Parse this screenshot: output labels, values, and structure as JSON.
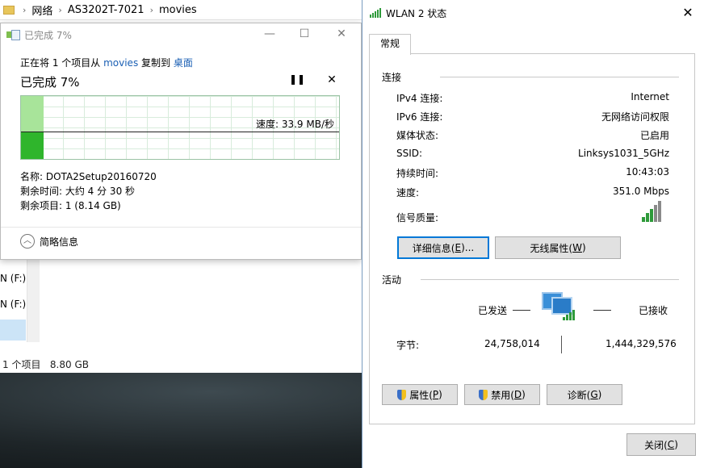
{
  "explorer": {
    "breadcrumb": [
      "网络",
      "AS3202T-7021",
      "movies"
    ],
    "nav_items": [
      "N (F:)",
      "N (F:)"
    ],
    "status_count": "1 个项目",
    "status_size": "8.80 GB"
  },
  "copy_dialog": {
    "title": "已完成 7%",
    "line_prefix": "正在将 1 个项目从",
    "source": "movies",
    "line_mid": "复制到",
    "destination": "桌面",
    "percent_label": "已完成 7%",
    "progress_fraction": 0.07,
    "speed_label": "速度: 33.9 MB/秒",
    "name_row": "名称:  DOTA2Setup20160720",
    "time_row": "剩余时间:  大约 4 分 30 秒",
    "items_row": "剩余项目:  1 (8.14 GB)",
    "collapse_label": "简略信息",
    "pause_icon": "pause-icon",
    "cancel_icon": "close-icon"
  },
  "wlan_dialog": {
    "title": "WLAN 2 状态",
    "tab": "常规",
    "connection_header": "连接",
    "rows": [
      {
        "label": "IPv4 连接:",
        "value": "Internet"
      },
      {
        "label": "IPv6 连接:",
        "value": "无网络访问权限"
      },
      {
        "label": "媒体状态:",
        "value": "已启用"
      },
      {
        "label": "SSID:",
        "value": "Linksys1031_5GHz"
      },
      {
        "label": "持续时间:",
        "value": "10:43:03"
      },
      {
        "label": "速度:",
        "value": "351.0 Mbps"
      }
    ],
    "signal_label": "信号质量:",
    "signal_bars_on": 3,
    "signal_bars_total": 5,
    "details_button": "详细信息(E)...",
    "details_button_main": "详细信息(",
    "details_button_key": "E",
    "details_button_tail": ")...",
    "wireless_button_main": "无线属性(",
    "wireless_button_key": "W",
    "wireless_button_tail": ")",
    "activity_header": "活动",
    "sent_label": "已发送",
    "received_label": "已接收",
    "bytes_label": "字节:",
    "bytes_sent": "24,758,014",
    "bytes_received": "1,444,329,576",
    "properties_main": "属性(",
    "properties_key": "P",
    "properties_tail": ")",
    "disable_main": "禁用(",
    "disable_key": "D",
    "disable_tail": ")",
    "diagnose_main": "诊断(",
    "diagnose_key": "G",
    "diagnose_tail": ")",
    "close_main": "关闭(",
    "close_key": "C",
    "close_tail": ")",
    "accent_color": "#0078d7"
  }
}
